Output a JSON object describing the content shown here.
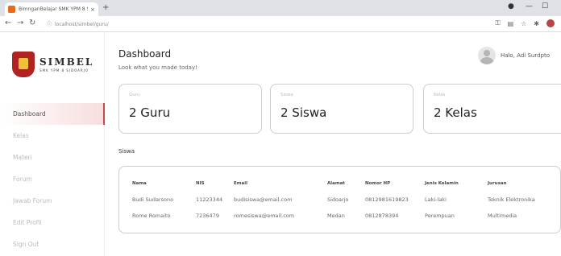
{
  "browser": {
    "tab_title": "BimnganBelajar SMK YPM 8 Sl",
    "tab_close": "×",
    "new_tab": "+",
    "url_icon": "info-circle-icon",
    "url": "localhost/simbel/guru/",
    "icons": [
      "key-icon",
      "extensions-icon",
      "star-icon",
      "puzzle-icon",
      "profile-icon"
    ]
  },
  "sidebar": {
    "logo_name": "SIMBEL",
    "logo_sub": "SMK YPM 8 SIDOARJO",
    "items": [
      {
        "label": "Dashboard",
        "active": true
      },
      {
        "label": "Kelas"
      },
      {
        "label": "Materi"
      },
      {
        "label": "Forum"
      },
      {
        "label": "Jawab Forum"
      },
      {
        "label": "Edit Profil"
      },
      {
        "label": "Sign Out"
      }
    ]
  },
  "header": {
    "title": "Dashboard",
    "subtitle": "Look what you made today!",
    "user_name": "Halo, Adi Surdpto"
  },
  "cards": [
    {
      "label": "Guru",
      "value": "2 Guru"
    },
    {
      "label": "Siswa",
      "value": "2 Siswa"
    },
    {
      "label": "Kelas",
      "value": "2 Kelas"
    }
  ],
  "siswa": {
    "title": "Siswa",
    "columns": [
      "Nama",
      "NIS",
      "Email",
      "Alamat",
      "Nomor HP",
      "Jenis Kelamin",
      "Jurusan"
    ],
    "rows": [
      [
        "Budi Sudarsono",
        "11223344",
        "budisiswa@email.com",
        "Sidoarjo",
        "0812981619823",
        "Laki-laki",
        "Teknik Elektronika"
      ],
      [
        "Rome Romaito",
        "7236479",
        "romesiswa@email.com",
        "Medan",
        "0812878394",
        "Perempuan",
        "Multimedia"
      ]
    ]
  }
}
